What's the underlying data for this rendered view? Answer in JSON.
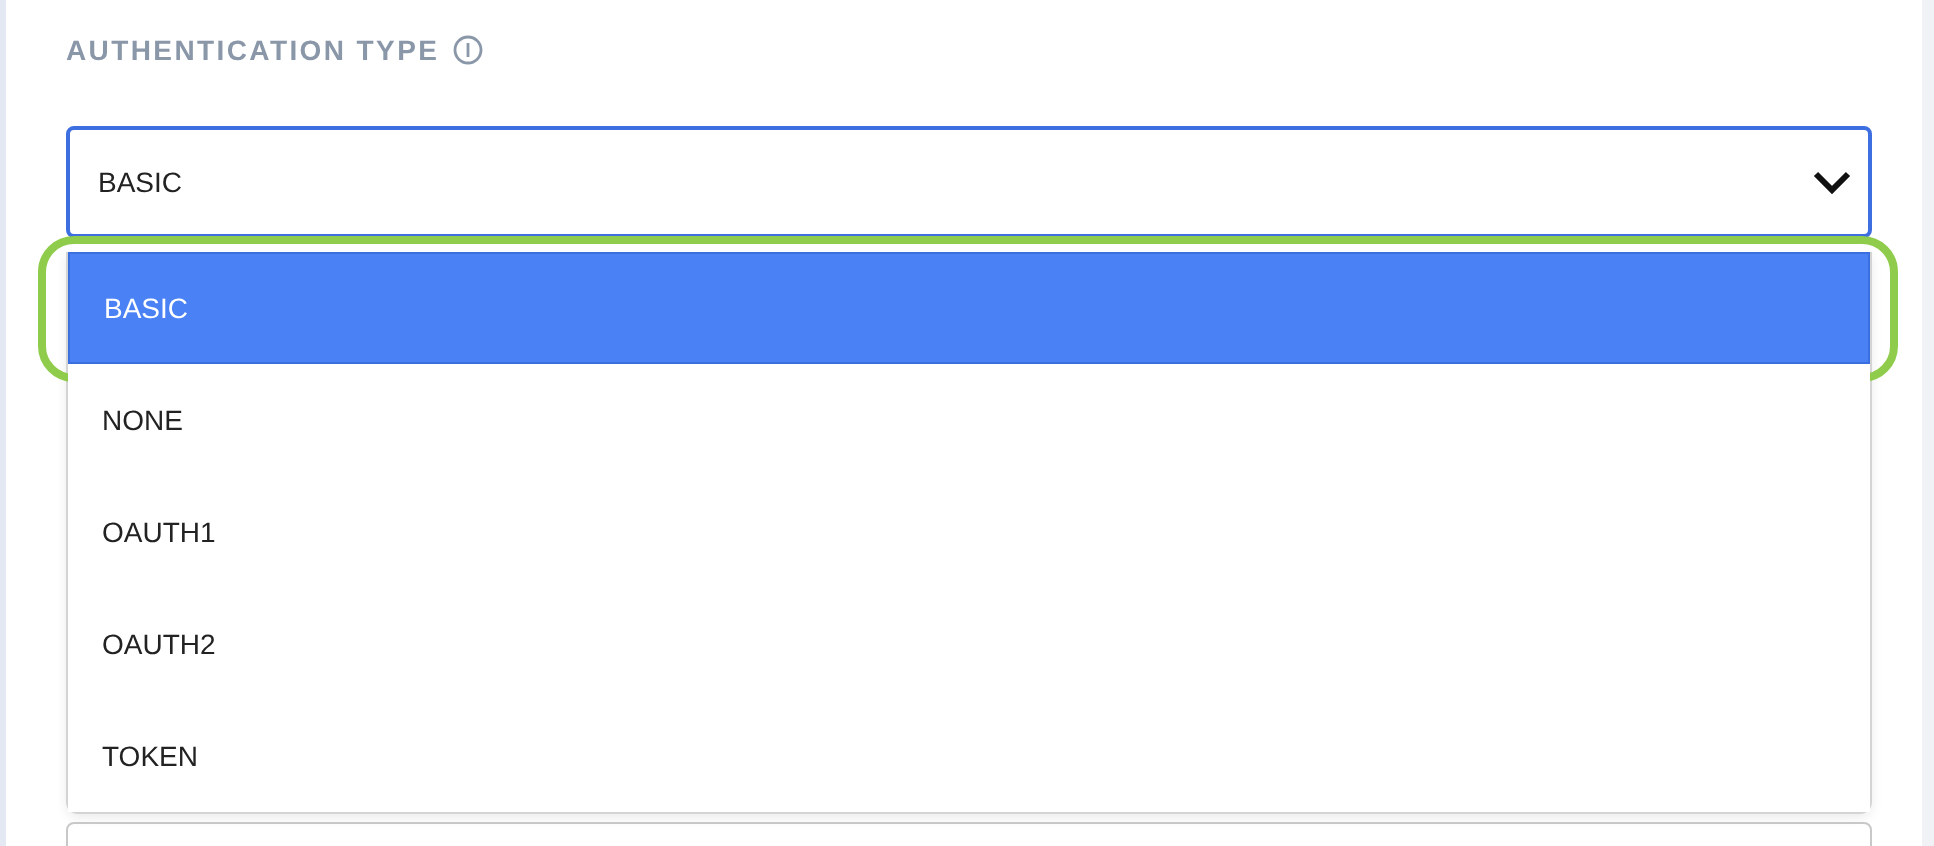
{
  "field": {
    "label": "AUTHENTICATION TYPE",
    "value": "BASIC",
    "expanded": true
  },
  "options": [
    {
      "label": "BASIC",
      "selected": true,
      "highlighted": true
    },
    {
      "label": "NONE",
      "selected": false,
      "highlighted": false
    },
    {
      "label": "OAUTH1",
      "selected": false,
      "highlighted": false
    },
    {
      "label": "OAUTH2",
      "selected": false,
      "highlighted": false
    },
    {
      "label": "TOKEN",
      "selected": false,
      "highlighted": false
    }
  ]
}
